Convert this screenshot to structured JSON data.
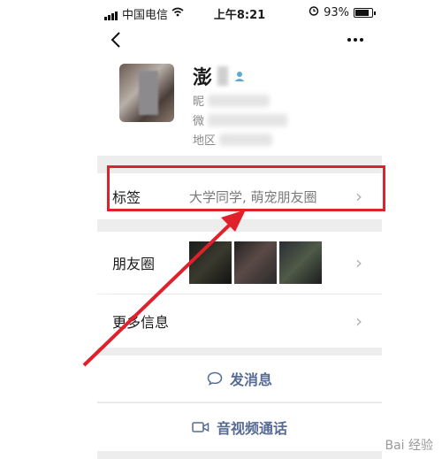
{
  "status_bar": {
    "carrier": "中国电信",
    "time": "上午8:21",
    "battery_percent": "93%"
  },
  "profile": {
    "name_char": "澎",
    "line1_prefix": "昵",
    "line2_prefix": "微",
    "line3_prefix": "地区"
  },
  "rows": {
    "tags": {
      "label": "标签",
      "value": "大学同学, 萌宠朋友圈"
    },
    "moments": {
      "label": "朋友圈"
    },
    "more_info": {
      "label": "更多信息"
    }
  },
  "actions": {
    "message": "发消息",
    "video_call": "音视频通话"
  },
  "icons": {
    "back": "chevron-left-icon",
    "more": "more-dots-icon",
    "message": "chat-bubble-icon",
    "video": "video-camera-icon"
  },
  "colors": {
    "link": "#576b95",
    "highlight": "#e0202a"
  },
  "watermark": "Bai 经验"
}
